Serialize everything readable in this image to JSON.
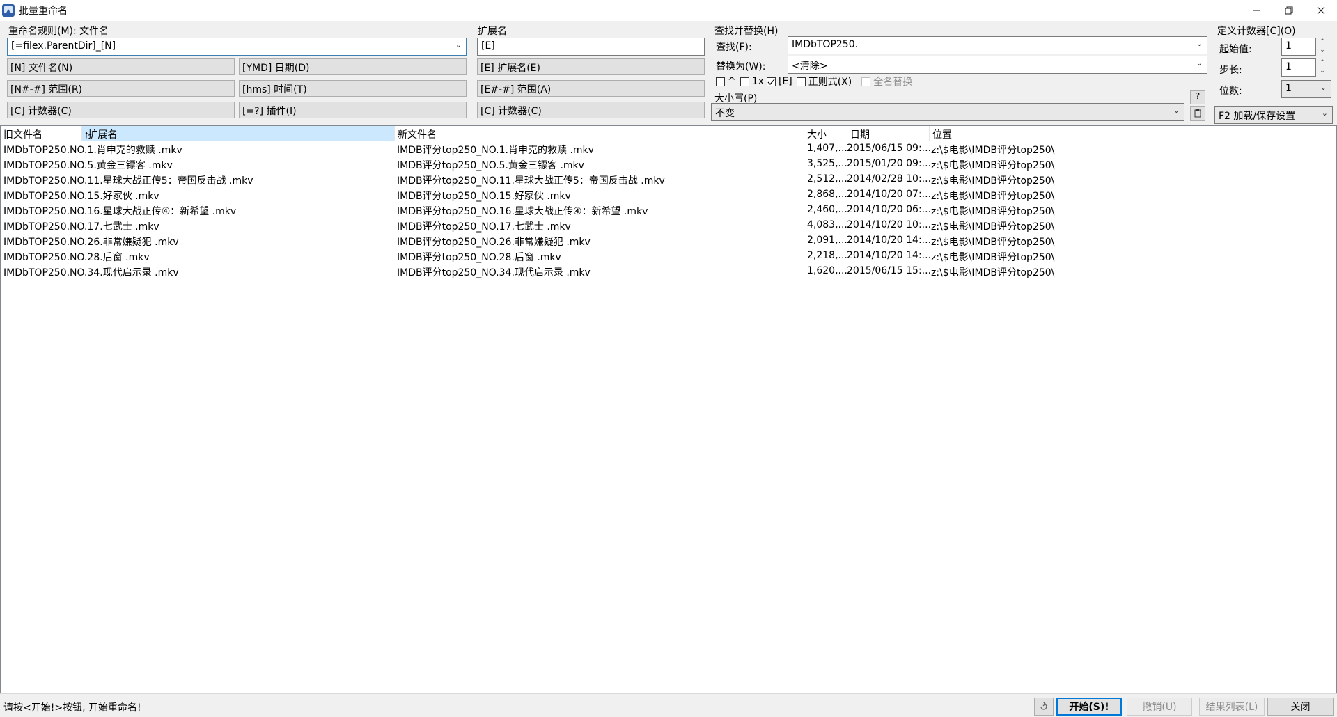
{
  "window": {
    "title": "批量重命名",
    "minimize_icon": "minimize-icon",
    "restore_icon": "restore-icon",
    "close_icon": "close-icon"
  },
  "rename_rule": {
    "label": "重命名规则(M): 文件名",
    "value": "[=filex.ParentDir]_[N]",
    "buttons": {
      "n": "[N] 文件名(N)",
      "ymd": "[YMD] 日期(D)",
      "range": "[N#-#] 范围(R)",
      "hms": "[hms] 时间(T)",
      "counter": "[C] 计数器(C)",
      "plugin": "[=?] 插件(I)"
    }
  },
  "extension": {
    "label": "扩展名",
    "value": "[E]",
    "buttons": {
      "ext": "[E] 扩展名(E)",
      "range": "[E#-#] 范围(A)",
      "counter": "[C] 计数器(C)"
    }
  },
  "find_replace": {
    "label": "查找并替换(H)",
    "find_label": "查找(F):",
    "find_value": "IMDbTOP250.",
    "replace_label": "替换为(W):",
    "replace_value": "<清除>",
    "opt_caret": "^",
    "opt_1x": "1x",
    "opt_e": "[E]",
    "opt_e_checked": true,
    "opt_regex": "正则式(X)",
    "opt_fullname": "全名替换",
    "help_label": "?",
    "case_label": "大小写(P)",
    "case_value": "不变"
  },
  "counter": {
    "label": "定义计数器[C](O)",
    "start_label": "起始值:",
    "start_value": "1",
    "step_label": "步长:",
    "step_value": "1",
    "digits_label": "位数:",
    "digits_value": "1",
    "settings_label": "F2 加载/保存设置"
  },
  "list": {
    "columns": [
      "旧文件名",
      "扩展名",
      "新文件名",
      "大小",
      "日期",
      "位置"
    ],
    "sort_icon": "sort-up-arrow-icon",
    "rows": [
      {
        "old": "IMDbTOP250.NO.1.肖申克的救赎 .mkv",
        "new": "IMDB评分top250_NO.1.肖申克的救赎 .mkv",
        "size": "1,407,...",
        "date": "2015/06/15 09:...",
        "loc": "z:\\$电影\\IMDB评分top250\\"
      },
      {
        "old": "IMDbTOP250.NO.5.黄金三镖客 .mkv",
        "new": "IMDB评分top250_NO.5.黄金三镖客 .mkv",
        "size": "3,525,...",
        "date": "2015/01/20 09:...",
        "loc": "z:\\$电影\\IMDB评分top250\\"
      },
      {
        "old": "IMDbTOP250.NO.11.星球大战正传5：帝国反击战 .mkv",
        "new": "IMDB评分top250_NO.11.星球大战正传5：帝国反击战 .mkv",
        "size": "2,512,...",
        "date": "2014/02/28 10:...",
        "loc": "z:\\$电影\\IMDB评分top250\\"
      },
      {
        "old": "IMDbTOP250.NO.15.好家伙 .mkv",
        "new": "IMDB评分top250_NO.15.好家伙 .mkv",
        "size": "2,868,...",
        "date": "2014/10/20 07:...",
        "loc": "z:\\$电影\\IMDB评分top250\\"
      },
      {
        "old": "IMDbTOP250.NO.16.星球大战正传④：新希望 .mkv",
        "new": "IMDB评分top250_NO.16.星球大战正传④：新希望 .mkv",
        "size": "2,460,...",
        "date": "2014/10/20 06:...",
        "loc": "z:\\$电影\\IMDB评分top250\\"
      },
      {
        "old": "IMDbTOP250.NO.17.七武士 .mkv",
        "new": "IMDB评分top250_NO.17.七武士 .mkv",
        "size": "4,083,...",
        "date": "2014/10/20 10:...",
        "loc": "z:\\$电影\\IMDB评分top250\\"
      },
      {
        "old": "IMDbTOP250.NO.26.非常嫌疑犯 .mkv",
        "new": "IMDB评分top250_NO.26.非常嫌疑犯 .mkv",
        "size": "2,091,...",
        "date": "2014/10/20 14:...",
        "loc": "z:\\$电影\\IMDB评分top250\\"
      },
      {
        "old": "IMDbTOP250.NO.28.后窗 .mkv",
        "new": "IMDB评分top250_NO.28.后窗 .mkv",
        "size": "2,218,...",
        "date": "2014/10/20 14:...",
        "loc": "z:\\$电影\\IMDB评分top250\\"
      },
      {
        "old": "IMDbTOP250.NO.34.现代启示录 .mkv",
        "new": "IMDB评分top250_NO.34.现代启示录 .mkv",
        "size": "1,620,...",
        "date": "2015/06/15 15:...",
        "loc": "z:\\$电影\\IMDB评分top250\\"
      }
    ]
  },
  "status": {
    "message": "请按<开始!>按钮, 开始重命名!",
    "start": "开始(S)!",
    "undo": "撤销(U)",
    "result_list": "结果列表(L)",
    "close": "关闭"
  }
}
